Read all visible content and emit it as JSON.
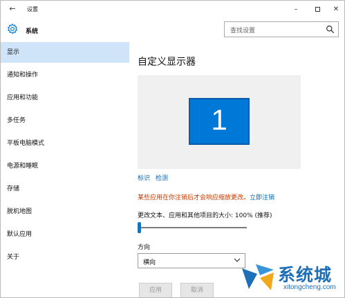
{
  "window": {
    "back_glyph": "←",
    "title": "设置",
    "minimize_glyph": "–",
    "close_glyph": "✕"
  },
  "header": {
    "app_name": "系统",
    "search_placeholder": "查找设置"
  },
  "sidebar": {
    "items": [
      {
        "label": "显示",
        "active": true
      },
      {
        "label": "通知和操作"
      },
      {
        "label": "应用和功能"
      },
      {
        "label": "多任务"
      },
      {
        "label": "平板电脑模式"
      },
      {
        "label": "电源和睡眠"
      },
      {
        "label": "存储"
      },
      {
        "label": "脱机地图"
      },
      {
        "label": "默认应用"
      },
      {
        "label": "关于"
      }
    ]
  },
  "main": {
    "title": "自定义显示器",
    "monitor_number": "1",
    "identify_link": "标识",
    "detect_link": "检测",
    "warning_text": "某些应用在你注销后才会响应缩放更改。",
    "signout_link": "立即注销",
    "scale_label": "更改文本、应用和其他项目的大小: 100% (推荐)",
    "scale_fraction": 0,
    "orientation_label": "方向",
    "orientation_value": "横向",
    "apply_button": "应用",
    "cancel_button": "取消"
  },
  "watermark": {
    "text": "系统城",
    "sub": "xitongcheng.com"
  },
  "colors": {
    "accent": "#0078d7",
    "active_item_bg": "#cfe4f8",
    "warning": "#c53a00",
    "link": "#0067b8"
  },
  "icons": {
    "back": "back-arrow-icon",
    "gear": "gear-icon",
    "search": "search-icon",
    "chevron": "chevron-down-icon"
  }
}
